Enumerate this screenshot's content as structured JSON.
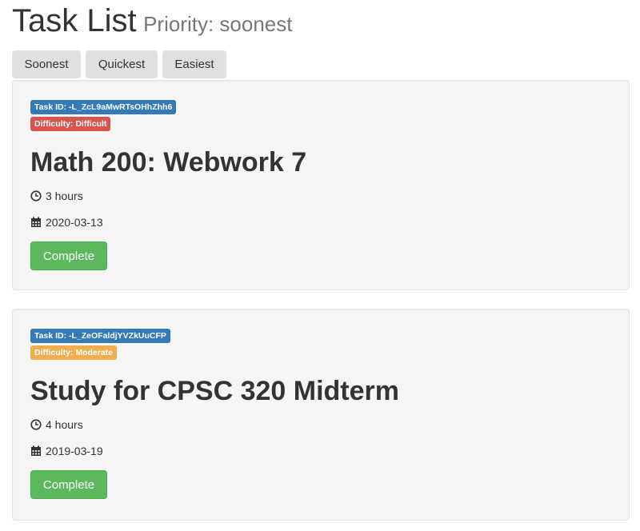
{
  "header": {
    "title": "Task List",
    "subtitle": "Priority: soonest"
  },
  "sort_buttons": [
    "Soonest",
    "Quickest",
    "Easiest"
  ],
  "colors": {
    "id_label": "#337ab7",
    "difficult": "#d9534f",
    "moderate": "#f0ad4e",
    "complete": "#5cb85c"
  },
  "tasks": [
    {
      "id_label": "Task ID: -L_ZcL9aMwRTsOHhZhh6",
      "difficulty_label": "Difficulty: Difficult",
      "name": "Math 200: Webwork 7",
      "duration": "3 hours",
      "date": "2020-03-13",
      "action": "Complete"
    },
    {
      "id_label": "Task ID: -L_ZeOFaldjYVZkUuCFP",
      "difficulty_label": "Difficulty: Moderate",
      "name": "Study for CPSC 320 Midterm",
      "duration": "4 hours",
      "date": "2019-03-19",
      "action": "Complete"
    }
  ]
}
